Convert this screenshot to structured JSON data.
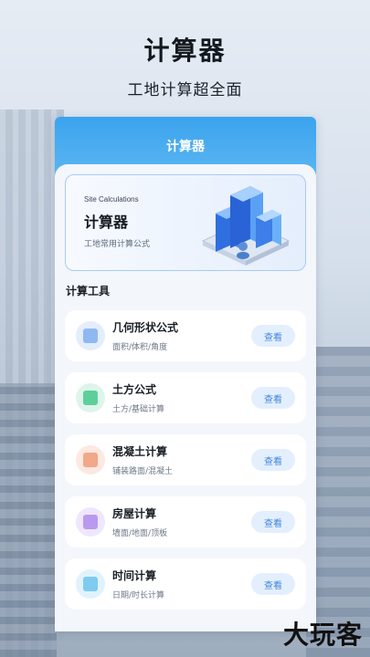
{
  "hero": {
    "title": "计算器",
    "subtitle": "工地计算超全面"
  },
  "app": {
    "header_title": "计算器",
    "banner": {
      "caption": "Site Calculations",
      "title": "计算器",
      "description": "工地常用计算公式"
    },
    "section_title": "计算工具",
    "view_label": "查看",
    "tools": [
      {
        "name": "几何形状公式",
        "desc": "面积/体积/角度",
        "icon": "geometry-icon",
        "color": "#8fb8f3",
        "bg": "#e3edfc"
      },
      {
        "name": "土方公式",
        "desc": "土方/基础计算",
        "icon": "earthwork-icon",
        "color": "#5fcf9a",
        "bg": "#ddf5ea"
      },
      {
        "name": "混凝土计算",
        "desc": "铺装路面/混凝土",
        "icon": "concrete-icon",
        "color": "#f2a78a",
        "bg": "#fde9e1"
      },
      {
        "name": "房屋计算",
        "desc": "墙面/地面/顶板",
        "icon": "house-icon",
        "color": "#b99af0",
        "bg": "#efe7fd"
      },
      {
        "name": "时间计算",
        "desc": "日期/时长计算",
        "icon": "calendar-icon",
        "color": "#7ecbf0",
        "bg": "#e0f3fc"
      }
    ]
  },
  "watermark": "大玩客"
}
